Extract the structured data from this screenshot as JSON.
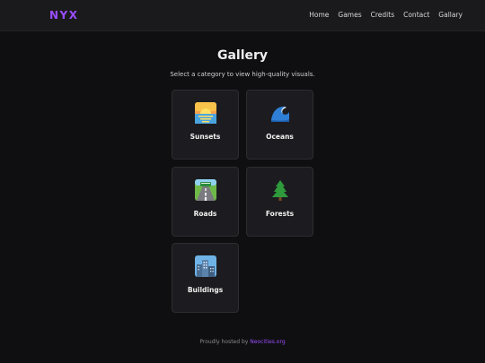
{
  "header": {
    "logo": "NYX",
    "nav": [
      {
        "label": "Home"
      },
      {
        "label": "Games"
      },
      {
        "label": "Credits"
      },
      {
        "label": "Contact"
      },
      {
        "label": "Gallary"
      }
    ]
  },
  "main": {
    "title": "Gallery",
    "subtitle": "Select a category to view high-quality visuals.",
    "categories": [
      {
        "label": "Sunsets",
        "icon": "sunset-icon"
      },
      {
        "label": "Oceans",
        "icon": "wave-icon"
      },
      {
        "label": "Roads",
        "icon": "road-icon"
      },
      {
        "label": "Forests",
        "icon": "tree-icon"
      },
      {
        "label": "Buildings",
        "icon": "cityscape-icon"
      }
    ]
  },
  "footer": {
    "prefix": "Proudly hosted by",
    "link": "Neocities.org"
  },
  "colors": {
    "accent": "#9b4dff",
    "background": "#0f0f11",
    "card": "#1c1c20"
  }
}
